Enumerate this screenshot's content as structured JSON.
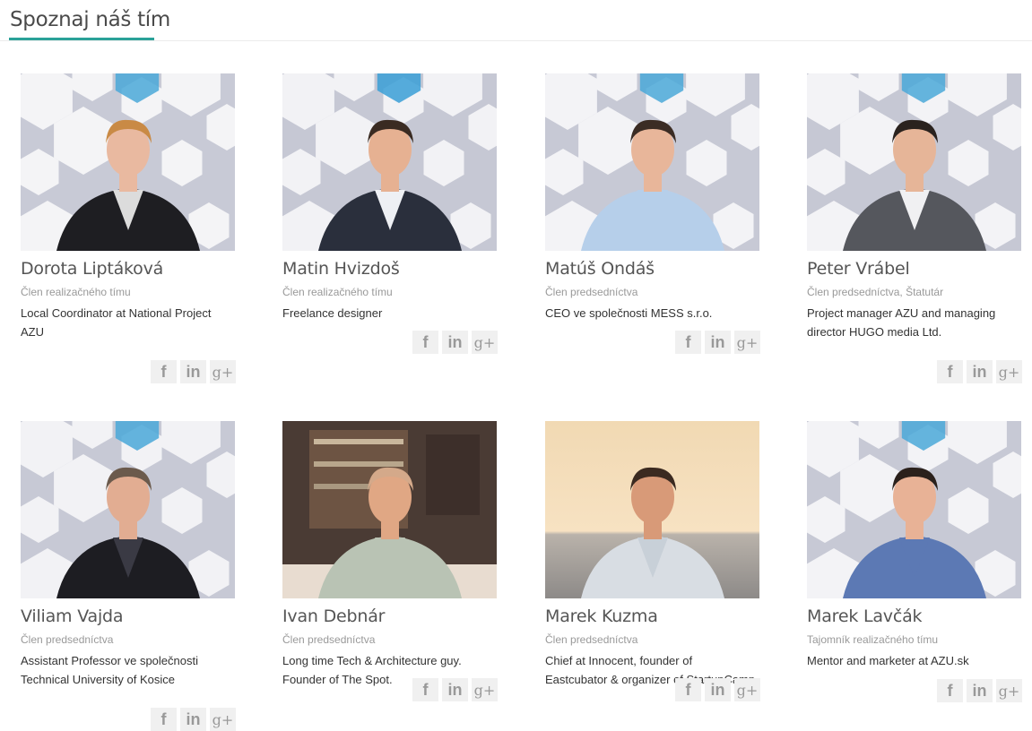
{
  "section": {
    "title": "Spoznaj náš tím"
  },
  "social_icons": {
    "facebook": "f",
    "linkedin": "in",
    "googleplus": "g+"
  },
  "members": [
    {
      "name": "Dorota Liptáková",
      "role": "Člen realizačného tímu",
      "bio": "Local Coordinator at National Project AZU"
    },
    {
      "name": "Matin Hvizdoš",
      "role": "Člen realizačného tímu",
      "bio": "Freelance designer"
    },
    {
      "name": "Matúš Ondáš",
      "role": "Člen predsedníctva",
      "bio": "CEO ve společnosti MESS s.r.o."
    },
    {
      "name": "Peter Vrábel",
      "role": "Člen predsedníctva, Štatutár",
      "bio": "Project manager AZU and managing director HUGO media Ltd."
    },
    {
      "name": "Viliam Vajda",
      "role": "Člen predsedníctva",
      "bio": "Assistant Professor ve společnosti Technical University of Kosice"
    },
    {
      "name": "Ivan Debnár",
      "role": "Člen predsedníctva",
      "bio": "Long time Tech & Architecture guy. Founder of The Spot."
    },
    {
      "name": "Marek Kuzma",
      "role": "Člen predsedníctva",
      "bio": "Chief at Innocent, founder of Eastcubator & organizer of StartupCamp"
    },
    {
      "name": "Marek Lavčák",
      "role": "Tajomník realizačného tímu",
      "bio": "Mentor and marketer at AZU.sk"
    }
  ]
}
